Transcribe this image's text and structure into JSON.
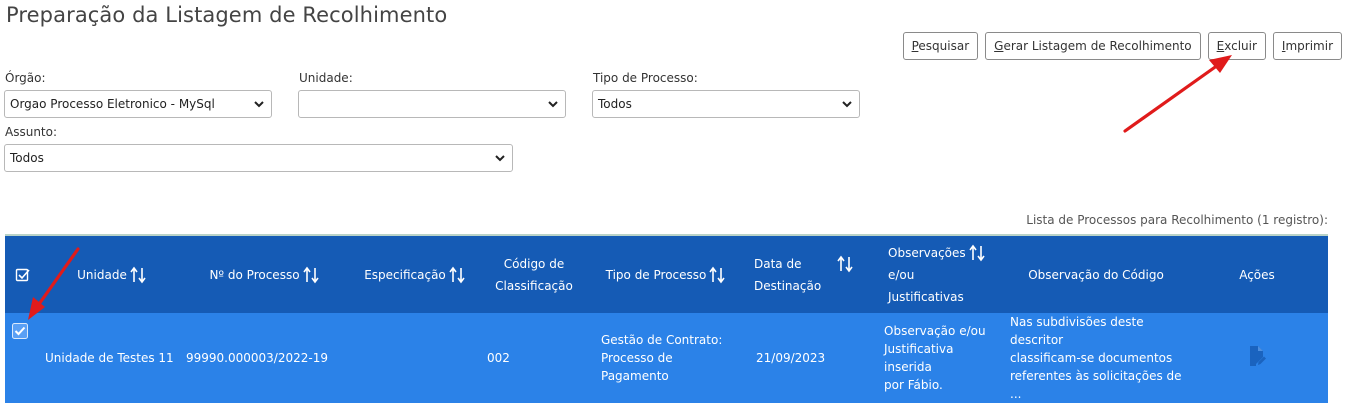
{
  "page": {
    "title": "Preparação da Listagem de Recolhimento"
  },
  "toolbar": {
    "pesquisar": {
      "mnemonic": "P",
      "rest": "esquisar"
    },
    "gerar": {
      "mnemonic": "G",
      "rest": "erar Listagem de Recolhimento"
    },
    "excluir": {
      "mnemonic": "E",
      "rest": "xcluir"
    },
    "imprimir": {
      "mnemonic": "I",
      "rest": "mprimir"
    }
  },
  "filters": {
    "orgao": {
      "label": "Órgão:",
      "value": "Orgao Processo Eletronico - MySql"
    },
    "unidade": {
      "label": "Unidade:",
      "value": ""
    },
    "tipo_processo": {
      "label": "Tipo de Processo:",
      "value": "Todos"
    },
    "assunto": {
      "label": "Assunto:",
      "value": "Todos"
    }
  },
  "table": {
    "caption": "Lista de Processos para Recolhimento (1 registro):",
    "headers": {
      "unidade": "Unidade",
      "numero": "Nº do Processo",
      "especificacao": "Especificação",
      "codigo_1": "Código de",
      "codigo_2": "Classificação",
      "tipo": "Tipo de Processo",
      "data_1": "Data de",
      "data_2": "Destinação",
      "obs_1": "Observações",
      "obs_2": "e/ou",
      "obs_3": "Justificativas",
      "obs_codigo": "Observação do Código",
      "acoes": "Ações"
    },
    "rows": [
      {
        "unidade": "Unidade de Testes 11",
        "numero": "99990.000003/2022-19",
        "especificacao": "",
        "codigo": "002",
        "tipo_1": "Gestão de Contrato:",
        "tipo_2": "Processo de Pagamento",
        "data": "21/09/2023",
        "obs_1": "Observação e/ou",
        "obs_2": "Justificativa inserida",
        "obs_3": "por Fábio.",
        "obs_codigo_1": "Nas subdivisões deste descritor",
        "obs_codigo_2": "classificam-se documentos",
        "obs_codigo_3": "referentes às solicitações de ..."
      }
    ]
  },
  "colors": {
    "header_bg": "#155bb5",
    "row_bg": "#2b82e8",
    "annotation_arrow": "#e01b1b"
  }
}
